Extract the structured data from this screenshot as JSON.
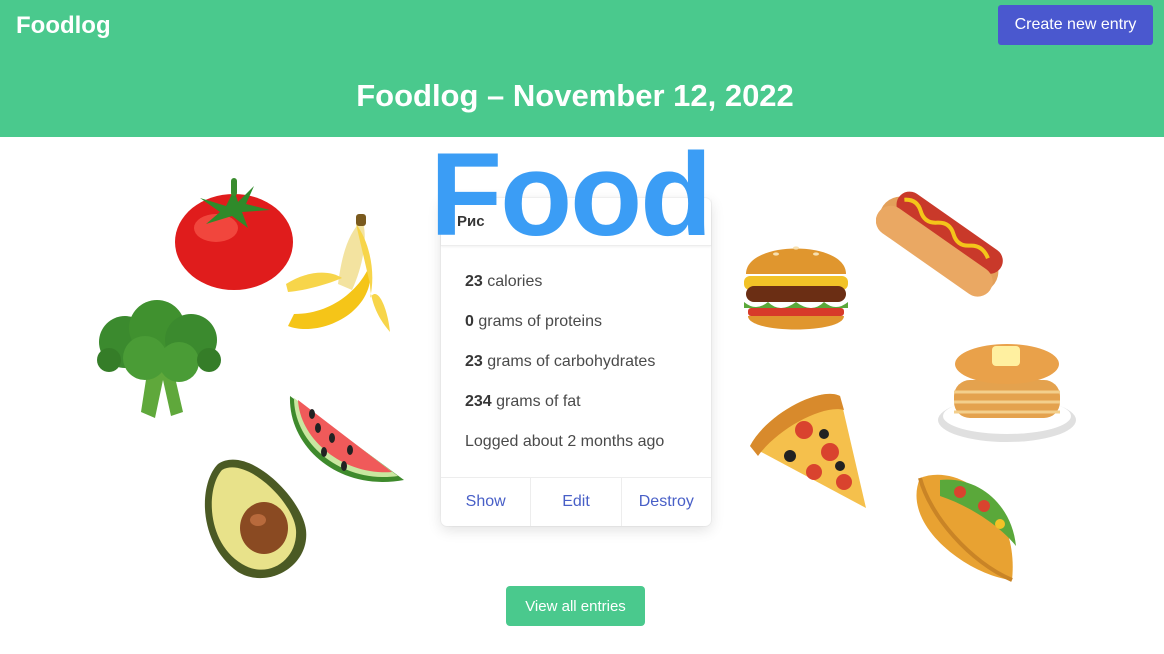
{
  "header": {
    "brand": "Foodlog",
    "new_entry_label": "Create new entry",
    "page_title": "Foodlog – November 12, 2022",
    "background_color": "#4ac98d",
    "button_color": "#4a58cf"
  },
  "overlay": {
    "text": "Food",
    "color": "#3b9df5"
  },
  "entry": {
    "name": "Рис",
    "calories_value": "23",
    "calories_label": " calories",
    "proteins_value": "0",
    "proteins_label": " grams of proteins",
    "carbs_value": "23",
    "carbs_label": " grams of carbohydrates",
    "fat_value": "234",
    "fat_label": " grams of fat",
    "logged": "Logged about 2 months ago",
    "actions": {
      "show": "Show",
      "edit": "Edit",
      "destroy": "Destroy"
    }
  },
  "footer": {
    "view_all_label": "View all entries"
  },
  "illustrations": [
    "tomato-icon",
    "banana-icon",
    "broccoli-icon",
    "watermelon-icon",
    "avocado-icon",
    "burger-icon",
    "hotdog-icon",
    "pancakes-icon",
    "pizza-icon",
    "taco-icon"
  ]
}
